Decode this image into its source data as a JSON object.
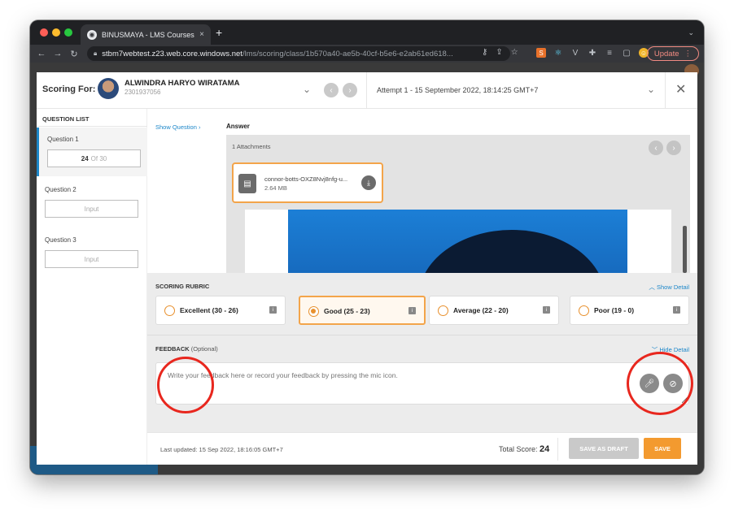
{
  "browser": {
    "tab_title": "BINUSMAYA - LMS Courses",
    "tab_close": "×",
    "new_tab": "+",
    "url_host": "stbm7webtest.z23.web.core.windows.net",
    "url_path": "/lms/scoring/class/1b570a40-ae5b-40cf-b5e6-e2ab61ed618...",
    "update_label": "Update"
  },
  "header": {
    "scoring_for_label": "Scoring For:",
    "student_name": "ALWINDRA HARYO WIRATAMA",
    "student_id": "2301937056",
    "attempt": "Attempt 1 - 15 September 2022, 18:14:25 GMT+7"
  },
  "question_list": {
    "title": "QUESTION LIST",
    "items": [
      {
        "label": "Question 1",
        "value": "24",
        "suffix": "Of 30",
        "placeholder": ""
      },
      {
        "label": "Question 2",
        "value": "",
        "suffix": "",
        "placeholder": "Input"
      },
      {
        "label": "Question 3",
        "value": "",
        "suffix": "",
        "placeholder": "Input"
      }
    ]
  },
  "show_question": "Show Question",
  "answer": {
    "title": "Answer",
    "attachment_count": "1 Attachments",
    "file_name": "connor-botts-OXZ8Nvj8nfg-u...",
    "file_size": "2.64 MB"
  },
  "rubric": {
    "title": "SCORING RUBRIC",
    "show_detail": "Show Detail",
    "options": [
      {
        "label": "Excellent (30 - 26)",
        "selected": false
      },
      {
        "label": "Good (25 - 23)",
        "selected": true
      },
      {
        "label": "Average (22 - 20)",
        "selected": false
      },
      {
        "label": "Poor (19 - 0)",
        "selected": false
      }
    ]
  },
  "feedback": {
    "title": "FEEDBACK",
    "optional": "(Optional)",
    "hide_detail": "Hide Detail",
    "placeholder": "Write your feedback here or record your feedback by pressing the mic icon."
  },
  "footer": {
    "last_updated": "Last updated: 15 Sep 2022, 18:16:05 GMT+7",
    "total_score_label": "Total Score:",
    "total_score_value": "24",
    "save_draft": "SAVE AS DRAFT",
    "save": "SAVE"
  },
  "colors": {
    "accent_blue": "#1d87c9",
    "accent_orange": "#f39a2f",
    "annotation_red": "#e8271e"
  }
}
